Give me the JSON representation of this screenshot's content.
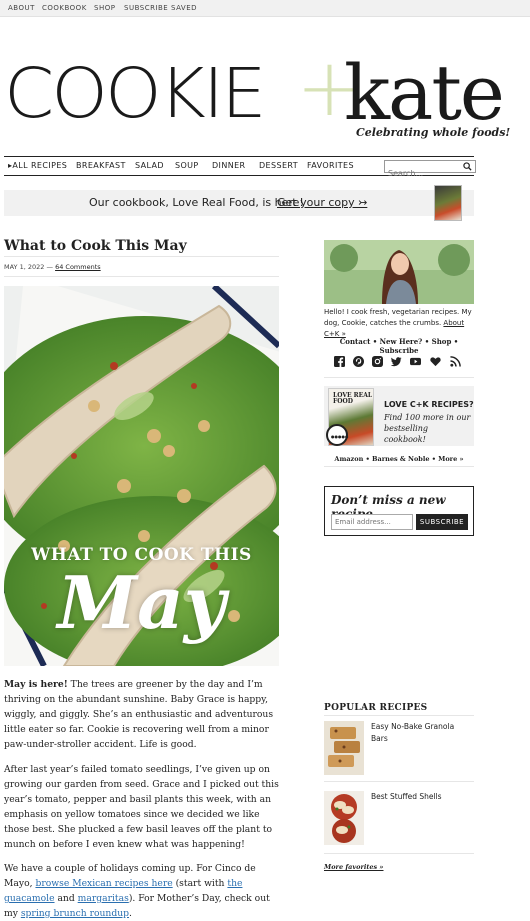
{
  "topbar": {
    "links": [
      "ABOUT",
      "COOKBOOK",
      "SHOP",
      "SUBSCRIBE",
      "SAVED"
    ]
  },
  "logo": {
    "cookie": "COOKIE",
    "plus": "+",
    "kate": "kate",
    "tagline": "Celebrating whole foods!"
  },
  "nav": {
    "items": [
      "▸ALL RECIPES",
      "BREAKFAST",
      "SALAD",
      "SOUP",
      "DINNER",
      "DESSERT",
      "FAVORITES"
    ],
    "search_placeholder": "Search...",
    "search_icon": "search-icon"
  },
  "banner": {
    "text": "Our cookbook, Love Real Food, is here!",
    "cta": "Get your copy ↣"
  },
  "post": {
    "title": "What to Cook This May",
    "date": "MAY 1, 2022",
    "separator": "—",
    "comments": "64 Comments",
    "hero_line1": "WHAT TO COOK THIS",
    "hero_line2": "May",
    "p1_lead": "May is here!",
    "p1_rest": " The trees are greener by the day and I’m thriving on the abundant sunshine. Baby Grace is happy, wiggly, and giggly. She’s an enthusiastic and adventurous little eater so far. Cookie is recovering well from a minor paw-under-stroller accident. Life is good.",
    "p2": "After last year’s failed tomato seedlings, I’ve given up on growing our garden from seed. Grace and I picked out this year’s tomato, pepper and basil plants this week, with an emphasis on yellow tomatoes since we decided we like those best. She plucked a few basil leaves off the plant to munch on before I even knew what was happening!",
    "p3_a": "We have a couple of holidays coming up. For Cinco de Mayo, ",
    "p3_link1": "browse Mexican recipes here",
    "p3_b": " (start with ",
    "p3_link2": "the guacamole",
    "p3_c": " and ",
    "p3_link3": "margaritas",
    "p3_d": "). For Mother’s Day, check out my ",
    "p3_link4": "spring brunch roundup",
    "p3_e": "."
  },
  "sidebar": {
    "about_text": "Hello! I cook fresh, vegetarian recipes. My dog, Cookie, catches the crumbs.",
    "about_more": "About C+K »",
    "links": "Contact • New Here? • Shop • Subscribe",
    "social_icons": [
      "facebook-icon",
      "pinterest-icon",
      "instagram-icon",
      "twitter-icon",
      "youtube-icon",
      "heart-icon",
      "rss-icon"
    ],
    "promo_book_title": "LOVE REAL FOOD",
    "promo_badge": "●●●●●",
    "promo_head": "LOVE C+K RECIPES?",
    "promo_sub": "Find 100 more in our bestselling cookbook!",
    "promo_links": "Amazon • Barnes & Noble • More »",
    "newsletter_title": "Don’t miss a new recipe",
    "newsletter_placeholder": "Email address...",
    "newsletter_button": "SUBSCRIBE",
    "popular_title": "POPULAR RECIPES",
    "popular": [
      {
        "name": "Easy No-Bake Granola Bars"
      },
      {
        "name": "Best Stuffed Shells"
      }
    ],
    "more_favorites": "More favorites »"
  },
  "colors": {
    "plus_green": "#d7e2b6",
    "link_blue": "#2a6fb0",
    "banner_bg": "#f1f1f1"
  }
}
